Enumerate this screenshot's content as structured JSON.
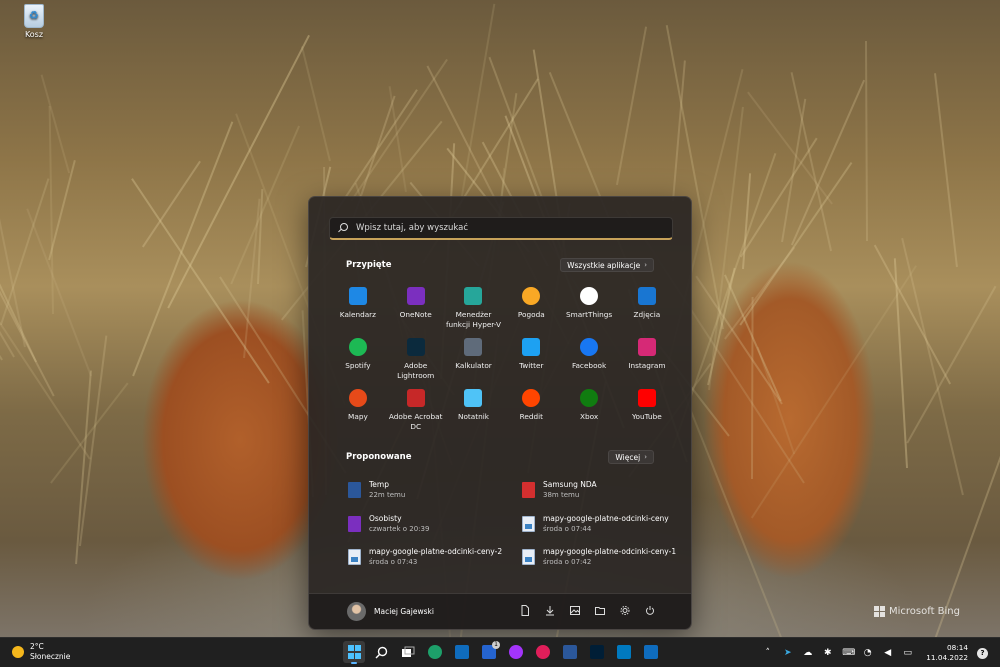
{
  "desktop": {
    "recycle_bin_label": "Kosz",
    "watermark": "Microsoft Bing"
  },
  "start_menu": {
    "search_placeholder": "Wpisz tutaj, aby wyszukać",
    "pinned": {
      "title": "Przypięte",
      "all_apps_label": "Wszystkie aplikacje",
      "apps": [
        {
          "label": "Kalendarz",
          "icon": "calendar-icon",
          "color": "#1e88e5"
        },
        {
          "label": "OneNote",
          "icon": "onenote-icon",
          "color": "#7b2fbf"
        },
        {
          "label": "Menedżer funkcji Hyper-V",
          "icon": "hyperv-icon",
          "color": "#26a69a"
        },
        {
          "label": "Pogoda",
          "icon": "weather-icon",
          "color": "#f9a825"
        },
        {
          "label": "SmartThings",
          "icon": "smartthings-icon",
          "color": "#ffffff"
        },
        {
          "label": "Zdjęcia",
          "icon": "photos-icon",
          "color": "#1976d2"
        },
        {
          "label": "Spotify",
          "icon": "spotify-icon",
          "color": "#1db954"
        },
        {
          "label": "Adobe Lightroom",
          "icon": "lightroom-icon",
          "color": "#0b2a3d"
        },
        {
          "label": "Kalkulator",
          "icon": "calculator-icon",
          "color": "#5f6b7a"
        },
        {
          "label": "Twitter",
          "icon": "twitter-icon",
          "color": "#1da1f2"
        },
        {
          "label": "Facebook",
          "icon": "facebook-icon",
          "color": "#1877f2"
        },
        {
          "label": "Instagram",
          "icon": "instagram-icon",
          "color": "#d62976"
        },
        {
          "label": "Mapy",
          "icon": "maps-icon",
          "color": "#e64a19"
        },
        {
          "label": "Adobe Acrobat DC",
          "icon": "acrobat-icon",
          "color": "#c62828"
        },
        {
          "label": "Notatnik",
          "icon": "notepad-icon",
          "color": "#4fc3f7"
        },
        {
          "label": "Reddit",
          "icon": "reddit-icon",
          "color": "#ff4500"
        },
        {
          "label": "Xbox",
          "icon": "xbox-icon",
          "color": "#107c10"
        },
        {
          "label": "YouTube",
          "icon": "youtube-icon",
          "color": "#ff0000"
        }
      ]
    },
    "recommended": {
      "title": "Proponowane",
      "more_label": "Więcej",
      "items": [
        {
          "name": "Temp",
          "time": "22m temu",
          "icon": "word-doc-icon",
          "color": "#2b579a"
        },
        {
          "name": "Samsung NDA",
          "time": "38m temu",
          "icon": "pdf-icon",
          "color": "#d32f2f"
        },
        {
          "name": "Osobisty",
          "time": "czwartek o 20:39",
          "icon": "onenote-doc-icon",
          "color": "#7b2fbf"
        },
        {
          "name": "mapy-google-platne-odcinki-ceny",
          "time": "środa o 07:44",
          "icon": "image-file-icon",
          "color": "#e8eef7"
        },
        {
          "name": "mapy-google-platne-odcinki-ceny-2",
          "time": "środa o 07:43",
          "icon": "image-file-icon",
          "color": "#e8eef7"
        },
        {
          "name": "mapy-google-platne-odcinki-ceny-1",
          "time": "środa o 07:42",
          "icon": "image-file-icon",
          "color": "#e8eef7"
        }
      ]
    },
    "user": {
      "name": "Maciej Gajewski"
    }
  },
  "taskbar": {
    "weather": {
      "temp": "2°C",
      "condition": "Słonecznie"
    },
    "apps": [
      {
        "icon": "windows-start-icon",
        "color": "#4cc2ff",
        "active": true
      },
      {
        "icon": "search-icon",
        "color": "#ffffff",
        "active": false
      },
      {
        "icon": "task-view-icon",
        "color": "#ffffff",
        "active": false
      },
      {
        "icon": "edge-icon",
        "color": "#1da06a",
        "active": false
      },
      {
        "icon": "mail-icon",
        "color": "#0f6cbd",
        "active": false
      },
      {
        "icon": "todo-icon",
        "color": "#2564cf",
        "active": false,
        "badge": "1"
      },
      {
        "icon": "messenger-icon",
        "color": "#a334fa",
        "active": false
      },
      {
        "icon": "slack-icon",
        "color": "#e01e5a",
        "active": false
      },
      {
        "icon": "word-icon",
        "color": "#2b579a",
        "active": false
      },
      {
        "icon": "photoshop-icon",
        "color": "#001e36",
        "active": false
      },
      {
        "icon": "trello-icon",
        "color": "#0079bf",
        "active": false
      },
      {
        "icon": "outlook-icon",
        "color": "#0f6cbd",
        "active": false
      }
    ],
    "clock": {
      "time": "08:14",
      "date": "11.04.2022"
    },
    "help_label": "?"
  }
}
